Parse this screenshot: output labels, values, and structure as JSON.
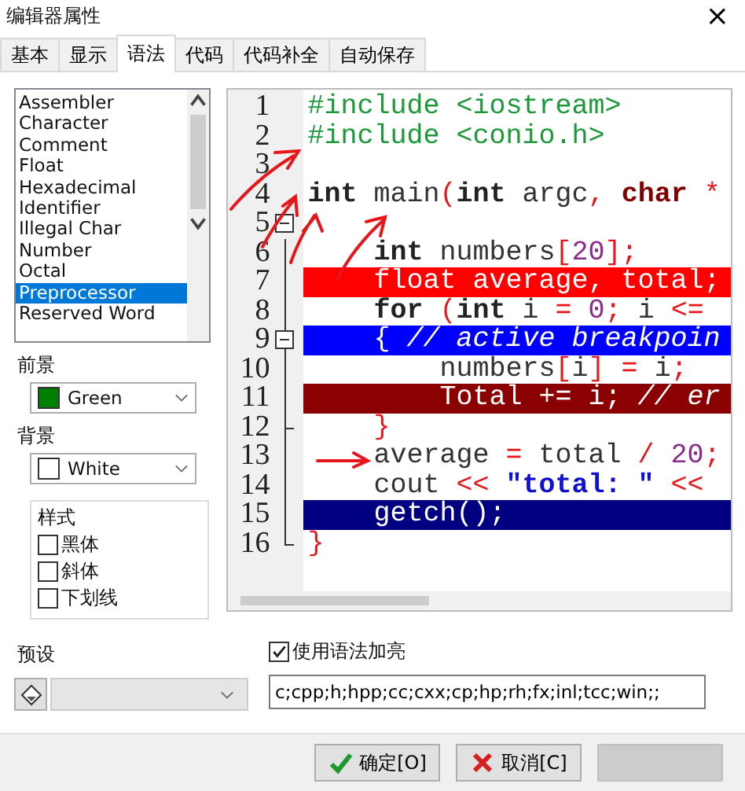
{
  "window": {
    "title": "编辑器属性",
    "close": "×"
  },
  "tabs": [
    {
      "label": "基本",
      "selected": false
    },
    {
      "label": "显示",
      "selected": false
    },
    {
      "label": "语法",
      "selected": true
    },
    {
      "label": "代码",
      "selected": false
    },
    {
      "label": "代码补全",
      "selected": false
    },
    {
      "label": "自动保存",
      "selected": false
    }
  ],
  "elements": [
    {
      "label": "Assembler",
      "selected": false
    },
    {
      "label": "Character",
      "selected": false
    },
    {
      "label": "Comment",
      "selected": false
    },
    {
      "label": "Float",
      "selected": false
    },
    {
      "label": "Hexadecimal",
      "selected": false
    },
    {
      "label": "Identifier",
      "selected": false
    },
    {
      "label": "Illegal Char",
      "selected": false
    },
    {
      "label": "Number",
      "selected": false
    },
    {
      "label": "Octal",
      "selected": false
    },
    {
      "label": "Preprocessor",
      "selected": true
    },
    {
      "label": "Reserved Word",
      "selected": false
    }
  ],
  "foreground": {
    "label": "前景",
    "value": "Green",
    "color": "#008000"
  },
  "background": {
    "label": "背景",
    "value": "White",
    "color": "#ffffff"
  },
  "style": {
    "label": "样式",
    "options": [
      {
        "label": "黑体",
        "checked": false
      },
      {
        "label": "斜体",
        "checked": false
      },
      {
        "label": "下划线",
        "checked": false
      }
    ]
  },
  "code": [
    {
      "number": "1",
      "tokens": [
        {
          "text": "#include <iostream>",
          "kind": "pre"
        }
      ]
    },
    {
      "number": "2",
      "tokens": [
        {
          "text": "#include <conio.h>",
          "kind": "pre"
        }
      ]
    },
    {
      "number": "3",
      "kind": "plain"
    },
    {
      "number": "4",
      "tokens": [
        {
          "text": "int",
          "kind": "kw"
        },
        {
          "text": " main",
          "kind": "id"
        },
        {
          "text": "(",
          "kind": "sym"
        },
        {
          "text": "int",
          "kind": "kw"
        },
        {
          "text": " argc",
          "kind": "id"
        },
        {
          "text": ", ",
          "kind": "sym"
        },
        {
          "text": "char",
          "kind": "kw2"
        },
        {
          "text": " *",
          "kind": "sym"
        }
      ]
    },
    {
      "number": "5",
      "kind": "foldstart"
    },
    {
      "number": "6",
      "tokens": [
        {
          "text": "    int",
          "kind": "kw"
        },
        {
          "text": " numbers",
          "kind": "id"
        },
        {
          "text": "[",
          "kind": "sym"
        },
        {
          "text": "20",
          "kind": "num"
        },
        {
          "text": "];",
          "kind": "sym"
        }
      ]
    },
    {
      "number": "7",
      "color": "#ff0000",
      "tokens": [
        {
          "text": "    float average, total;",
          "kind": "plain"
        }
      ]
    },
    {
      "number": "8",
      "tokens": [
        {
          "text": "    for",
          "kind": "kw"
        },
        {
          "text": " (",
          "kind": "sym"
        },
        {
          "text": "int",
          "kind": "kw"
        },
        {
          "text": " i ",
          "kind": "id"
        },
        {
          "text": "=",
          "kind": "sym"
        },
        {
          "text": " 0",
          "kind": "num"
        },
        {
          "text": ";",
          "kind": "sym"
        },
        {
          "text": " i ",
          "kind": "id"
        },
        {
          "text": "<=",
          "kind": "sym"
        }
      ]
    },
    {
      "number": "9",
      "kind": "foldstart",
      "color": "#0000ff",
      "tokens": [
        {
          "text": "    { ",
          "kind": "plain"
        },
        {
          "text": "// active breakpoin",
          "kind": "comment"
        }
      ]
    },
    {
      "number": "10",
      "tokens": [
        {
          "text": "        numbers",
          "kind": "id"
        },
        {
          "text": "[",
          "kind": "sym"
        },
        {
          "text": "i",
          "kind": "id"
        },
        {
          "text": "]",
          "kind": "sym"
        },
        {
          "text": " =",
          "kind": "sym"
        },
        {
          "text": " i",
          "kind": "id"
        },
        {
          "text": ";",
          "kind": "sym"
        }
      ]
    },
    {
      "number": "11",
      "color": "#8b0000",
      "tokens": [
        {
          "text": "        Total += i; ",
          "kind": "plain"
        },
        {
          "text": "// er",
          "kind": "comment"
        }
      ]
    },
    {
      "number": "12",
      "kind": "foldend",
      "tokens": [
        {
          "text": "    }",
          "kind": "sym"
        }
      ]
    },
    {
      "number": "13",
      "tokens": [
        {
          "text": "    average ",
          "kind": "id"
        },
        {
          "text": "=",
          "kind": "sym"
        },
        {
          "text": " total ",
          "kind": "id"
        },
        {
          "text": "/",
          "kind": "sym"
        },
        {
          "text": " 20",
          "kind": "num"
        },
        {
          "text": ";",
          "kind": "sym"
        }
      ]
    },
    {
      "number": "14",
      "tokens": [
        {
          "text": "    cout ",
          "kind": "id"
        },
        {
          "text": "<<",
          "kind": "sym"
        },
        {
          "text": " \"total: \"",
          "kind": "str"
        },
        {
          "text": " <<",
          "kind": "sym"
        }
      ]
    },
    {
      "number": "15",
      "color": "#000080",
      "tokens": [
        {
          "text": "    getch();",
          "kind": "plain"
        }
      ]
    },
    {
      "number": "16",
      "kind": "foldend",
      "tokens": [
        {
          "text": "}",
          "kind": "sym"
        }
      ]
    }
  ],
  "preset": {
    "label": "预设"
  },
  "syntax_highlight": {
    "label": "使用语法加亮",
    "checked": true
  },
  "extensions": {
    "value": "c;cpp;h;hpp;cc;cxx;cp;hp;rh;fx;inl;tcc;win;;"
  },
  "buttons": [
    {
      "label": "确定[O]",
      "kind": "ok",
      "disabled": false
    },
    {
      "label": "取消[C]",
      "kind": "cancel",
      "disabled": false
    },
    {
      "kind": "blank",
      "disabled": true
    }
  ]
}
